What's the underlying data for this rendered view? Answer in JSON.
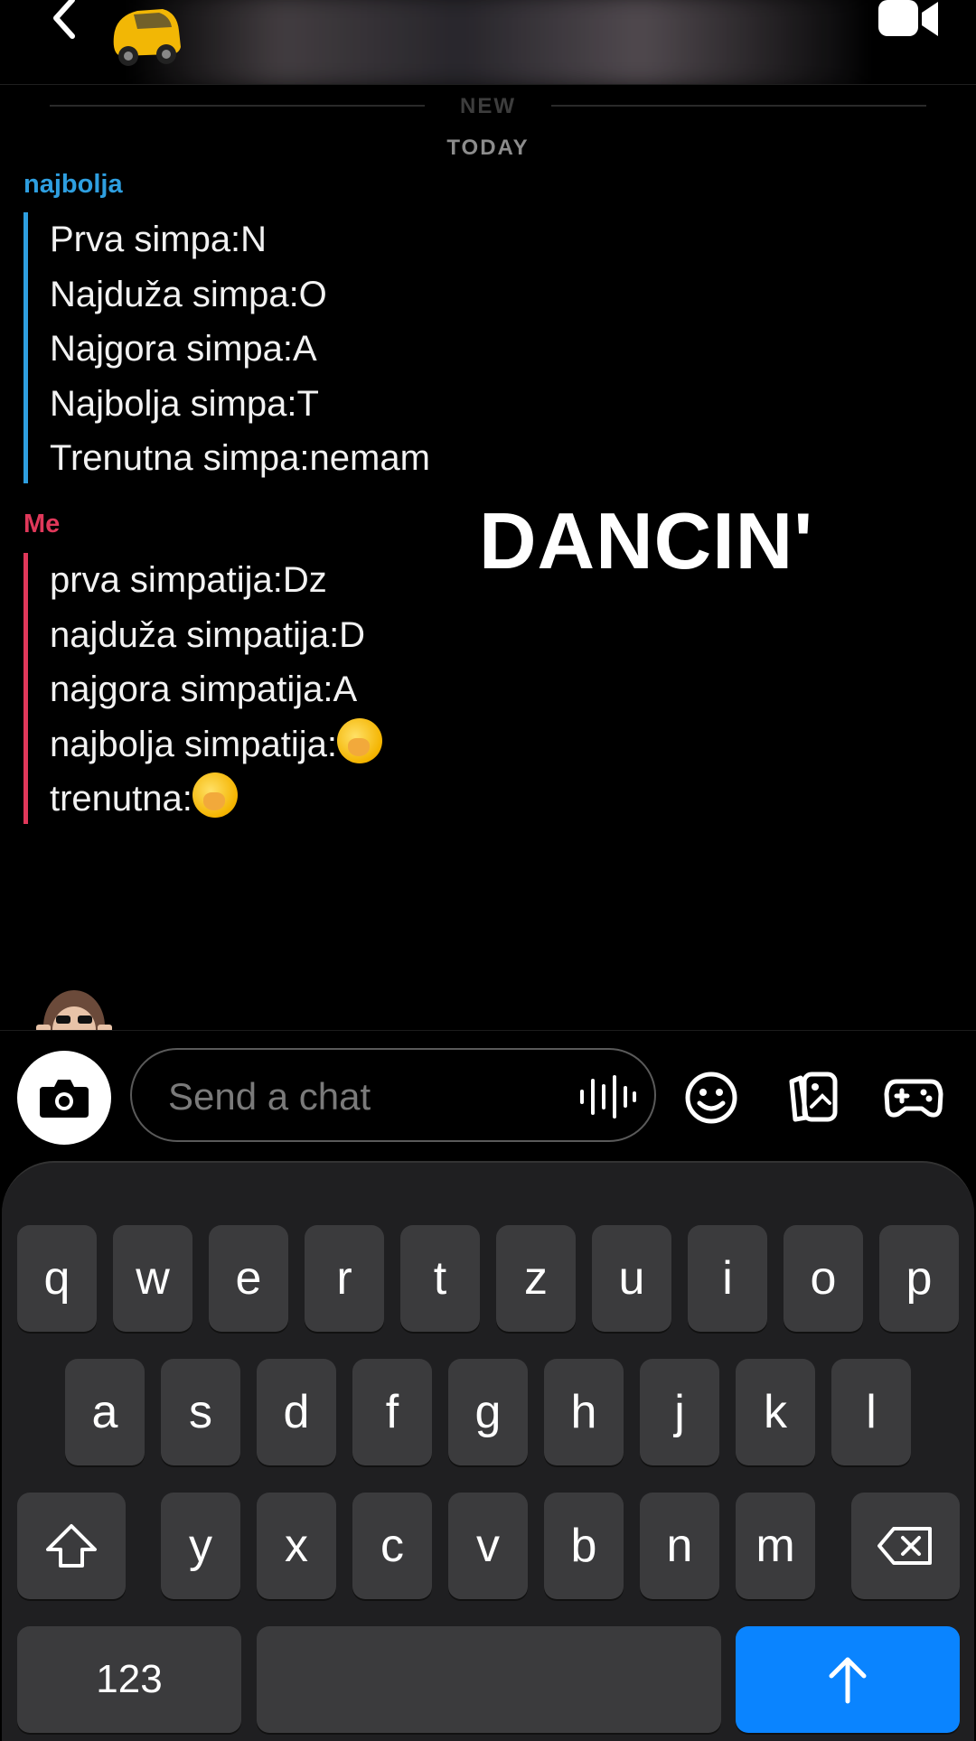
{
  "header": {
    "back_icon": "chevron-left-icon",
    "video_icon": "video-camera-icon"
  },
  "divider": {
    "new_label": "NEW",
    "today_label": "TODAY"
  },
  "conversation": {
    "friend": {
      "name": "najbolja",
      "color": "#2e9fe0",
      "lines": [
        "Prva simpa:N",
        "Najduža simpa:O",
        "Najgora simpa:A",
        "Najbolja simpa:T",
        "Trenutna simpa:nemam"
      ]
    },
    "me": {
      "name": "Me",
      "color": "#e0385a",
      "lines": [
        "prva simpatija:Dz",
        "najduža simpatija:D",
        "najgora simpatija:A",
        "najbolja simpatija:",
        "trenutna:"
      ],
      "emoji": "hand-over-mouth-emoji"
    }
  },
  "sticker_text": "DANCIN'",
  "input": {
    "placeholder": "Send a chat",
    "icons": [
      "camera-icon",
      "voice-waveform-icon",
      "smiley-icon",
      "memories-icon",
      "game-controller-icon"
    ]
  },
  "keyboard": {
    "row1": [
      "q",
      "w",
      "e",
      "r",
      "t",
      "z",
      "u",
      "i",
      "o",
      "p"
    ],
    "row2": [
      "a",
      "s",
      "d",
      "f",
      "g",
      "h",
      "j",
      "k",
      "l"
    ],
    "row3": [
      "y",
      "x",
      "c",
      "v",
      "b",
      "n",
      "m"
    ],
    "numbers_label": "123",
    "accent": "#0a84ff"
  }
}
